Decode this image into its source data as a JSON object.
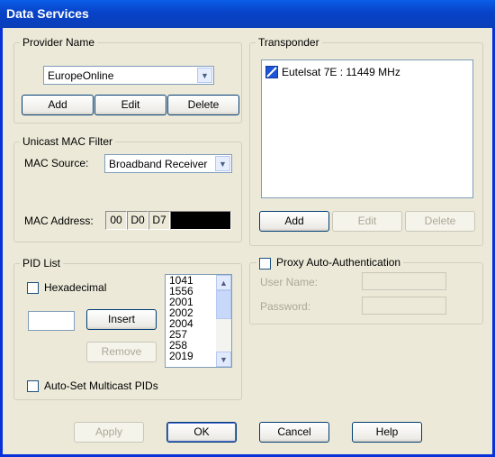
{
  "window": {
    "title": "Data Services"
  },
  "provider": {
    "legend": "Provider Name",
    "selected": "EuropeOnline",
    "add_label": "Add",
    "edit_label": "Edit",
    "delete_label": "Delete"
  },
  "mac_filter": {
    "legend": "Unicast MAC Filter",
    "source_label": "MAC Source:",
    "source_value": "Broadband Receiver",
    "address_label": "MAC Address:",
    "address_octets": [
      "00",
      "D0",
      "D7"
    ]
  },
  "pid_list": {
    "legend": "PID List",
    "hex_label": "Hexadecimal",
    "insert_label": "Insert",
    "remove_label": "Remove",
    "auto_multicast_label": "Auto-Set Multicast PIDs",
    "items": [
      "1041",
      "1556",
      "2001",
      "2002",
      "2004",
      "257",
      "258",
      "2019"
    ]
  },
  "transponder": {
    "legend": "Transponder",
    "items": [
      "Eutelsat 7E : 11449 MHz"
    ],
    "add_label": "Add",
    "edit_label": "Edit",
    "delete_label": "Delete"
  },
  "proxy": {
    "label": "Proxy Auto-Authentication",
    "user_label": "User Name:",
    "password_label": "Password:"
  },
  "buttons": {
    "apply": "Apply",
    "ok": "OK",
    "cancel": "Cancel",
    "help": "Help"
  },
  "colors": {
    "title_bar": "#0a5ee8",
    "dialog_bg": "#ece9d8"
  },
  "icons": {
    "transponder_item": "satellite-icon"
  }
}
